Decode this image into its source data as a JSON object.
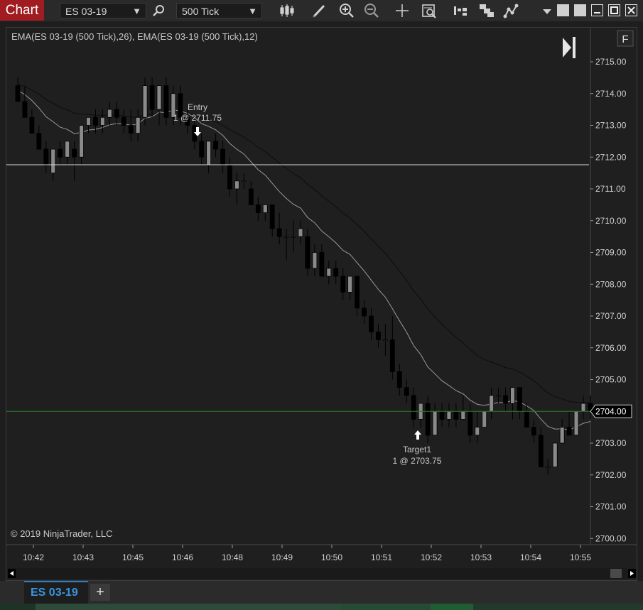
{
  "app": {
    "title_tab": "Chart"
  },
  "toolbar": {
    "instrument": "ES 03-19",
    "interval": "500 Tick",
    "icons": [
      "search-icon",
      "candlestick-icon",
      "pencil-icon",
      "zoom-in-icon",
      "zoom-out-icon",
      "crosshair-icon",
      "data-box-icon",
      "chart-trader-icon",
      "templates-icon",
      "strategies-icon",
      "chevron-down-icon",
      "restore-icon",
      "maximize-icon",
      "minimize-icon",
      "window-maximize-icon",
      "close-icon"
    ]
  },
  "chart": {
    "indicator_label": "EMA(ES 03-19 (500 Tick),26), EMA(ES 03-19 (500 Tick),12)",
    "f_button": "F",
    "copyright": "© 2019 NinjaTrader, LLC",
    "price_marker": "2704.00",
    "entry_label": "Entry",
    "entry_fill": "1 @ 2711.75",
    "target_label": "Target1",
    "target_fill": "1 @ 2703.75",
    "colors": {
      "background": "#1f1f1f",
      "up_candle": "#8a8a8a",
      "down_candle": "#000000",
      "ema_fast": "#9a9a9a",
      "ema_slow": "#0d0d0d",
      "price_line": "#2f7a32",
      "entry_line": "#d8d8d8"
    }
  },
  "chart_data": {
    "type": "candlestick",
    "y_ticks": [
      "2715.00",
      "2714.00",
      "2713.00",
      "2712.00",
      "2711.00",
      "2710.00",
      "2709.00",
      "2708.00",
      "2707.00",
      "2706.00",
      "2705.00",
      "2704.00",
      "2703.00",
      "2702.00",
      "2701.00",
      "2700.00"
    ],
    "x_ticks": [
      "10:42",
      "10:43",
      "10:45",
      "10:46",
      "10:48",
      "10:49",
      "10:50",
      "10:51",
      "10:52",
      "10:53",
      "10:54",
      "10:55"
    ],
    "ylim": [
      2699.6,
      2716.0
    ],
    "entry_price": 2711.75,
    "target_price": 2703.75,
    "current_price": 2704.0,
    "candles": [
      [
        2714.25,
        2714.5,
        2713.75,
        2713.75
      ],
      [
        2713.75,
        2714.25,
        2713.25,
        2713.25
      ],
      [
        2713.25,
        2713.5,
        2712.75,
        2712.75
      ],
      [
        2712.75,
        2713.0,
        2712.25,
        2712.25
      ],
      [
        2712.25,
        2712.5,
        2711.5,
        2711.75
      ],
      [
        2711.5,
        2712.25,
        2711.25,
        2712.25
      ],
      [
        2712.25,
        2712.5,
        2711.75,
        2712.0
      ],
      [
        2712.0,
        2712.5,
        2711.75,
        2712.5
      ],
      [
        2712.25,
        2712.5,
        2711.25,
        2712.0
      ],
      [
        2712.0,
        2713.0,
        2711.75,
        2713.0
      ],
      [
        2713.0,
        2713.25,
        2712.75,
        2713.25
      ],
      [
        2713.25,
        2713.5,
        2712.75,
        2713.0
      ],
      [
        2713.0,
        2713.5,
        2712.75,
        2713.25
      ],
      [
        2713.25,
        2713.75,
        2713.0,
        2713.5
      ],
      [
        2713.5,
        2713.75,
        2713.0,
        2713.25
      ],
      [
        2713.25,
        2713.5,
        2712.75,
        2713.0
      ],
      [
        2713.0,
        2713.5,
        2712.5,
        2712.75
      ],
      [
        2712.75,
        2713.5,
        2712.5,
        2713.25
      ],
      [
        2713.25,
        2714.5,
        2713.0,
        2714.25
      ],
      [
        2714.25,
        2714.5,
        2713.25,
        2713.5
      ],
      [
        2713.5,
        2714.25,
        2713.0,
        2714.25
      ],
      [
        2714.25,
        2714.5,
        2713.0,
        2713.25
      ],
      [
        2713.25,
        2714.25,
        2713.0,
        2714.0
      ],
      [
        2714.0,
        2714.25,
        2713.0,
        2713.25
      ],
      [
        2713.25,
        2713.5,
        2712.75,
        2713.0
      ],
      [
        2713.0,
        2713.25,
        2712.25,
        2712.5
      ],
      [
        2712.5,
        2712.75,
        2711.75,
        2712.0
      ],
      [
        2711.75,
        2712.5,
        2711.5,
        2712.5
      ],
      [
        2712.5,
        2712.75,
        2712.0,
        2712.25
      ],
      [
        2712.25,
        2712.5,
        2711.5,
        2711.75
      ],
      [
        2711.75,
        2712.0,
        2710.75,
        2711.0
      ],
      [
        2711.0,
        2711.5,
        2710.5,
        2711.25
      ],
      [
        2711.25,
        2711.5,
        2711.0,
        2711.25
      ],
      [
        2711.0,
        2711.25,
        2710.5,
        2710.5
      ],
      [
        2710.5,
        2710.75,
        2710.0,
        2710.25
      ],
      [
        2710.25,
        2710.5,
        2710.0,
        2710.5
      ],
      [
        2710.5,
        2710.5,
        2709.5,
        2709.75
      ],
      [
        2709.75,
        2710.25,
        2709.25,
        2709.5
      ],
      [
        2709.5,
        2709.75,
        2708.75,
        2709.5
      ],
      [
        2709.5,
        2710.0,
        2709.0,
        2709.5
      ],
      [
        2709.5,
        2710.0,
        2709.25,
        2709.75
      ],
      [
        2709.5,
        2709.75,
        2708.25,
        2708.5
      ],
      [
        2708.5,
        2709.25,
        2708.25,
        2709.0
      ],
      [
        2709.0,
        2709.25,
        2708.25,
        2708.25
      ],
      [
        2708.25,
        2708.75,
        2708.0,
        2708.5
      ],
      [
        2708.5,
        2708.75,
        2708.0,
        2708.25
      ],
      [
        2708.25,
        2708.5,
        2707.5,
        2707.75
      ],
      [
        2707.75,
        2708.25,
        2707.5,
        2708.25
      ],
      [
        2708.25,
        2708.25,
        2707.0,
        2707.25
      ],
      [
        2707.25,
        2707.5,
        2706.75,
        2707.0
      ],
      [
        2707.0,
        2707.25,
        2706.25,
        2706.5
      ],
      [
        2706.5,
        2706.75,
        2706.0,
        2706.25
      ],
      [
        2706.25,
        2706.75,
        2705.75,
        2706.25
      ],
      [
        2706.25,
        2707.0,
        2705.0,
        2705.25
      ],
      [
        2705.25,
        2705.5,
        2704.5,
        2704.75
      ],
      [
        2704.75,
        2705.0,
        2704.25,
        2704.5
      ],
      [
        2704.5,
        2704.75,
        2703.5,
        2703.75
      ],
      [
        2703.75,
        2704.25,
        2703.5,
        2704.25
      ],
      [
        2704.25,
        2704.5,
        2703.0,
        2703.25
      ],
      [
        2703.25,
        2704.25,
        2703.25,
        2704.0
      ],
      [
        2704.0,
        2704.25,
        2703.5,
        2703.75
      ],
      [
        2703.75,
        2704.25,
        2703.5,
        2704.0
      ],
      [
        2704.0,
        2704.25,
        2703.5,
        2703.75
      ],
      [
        2703.75,
        2704.5,
        2703.75,
        2704.0
      ],
      [
        2704.0,
        2704.25,
        2703.0,
        2703.25
      ],
      [
        2703.25,
        2704.0,
        2703.0,
        2703.5
      ],
      [
        2703.5,
        2704.0,
        2703.5,
        2704.0
      ],
      [
        2704.0,
        2704.75,
        2703.75,
        2704.5
      ],
      [
        2704.5,
        2704.75,
        2704.25,
        2704.5
      ],
      [
        2704.5,
        2704.75,
        2704.0,
        2704.25
      ],
      [
        2704.25,
        2704.75,
        2703.75,
        2704.75
      ],
      [
        2704.75,
        2704.75,
        2703.75,
        2704.0
      ],
      [
        2704.0,
        2704.25,
        2703.5,
        2703.5
      ],
      [
        2703.5,
        2703.75,
        2703.0,
        2703.25
      ],
      [
        2703.25,
        2703.5,
        2702.25,
        2702.25
      ],
      [
        2702.25,
        2702.5,
        2702.0,
        2702.25
      ],
      [
        2702.25,
        2703.0,
        2702.25,
        2703.0
      ],
      [
        2703.0,
        2703.75,
        2703.0,
        2703.5
      ],
      [
        2703.5,
        2704.0,
        2703.25,
        2703.25
      ],
      [
        2703.25,
        2704.0,
        2703.25,
        2704.0
      ],
      [
        2704.0,
        2704.5,
        2703.75,
        2704.25
      ],
      [
        2704.25,
        2704.5,
        2703.75,
        2704.0
      ]
    ]
  }
}
